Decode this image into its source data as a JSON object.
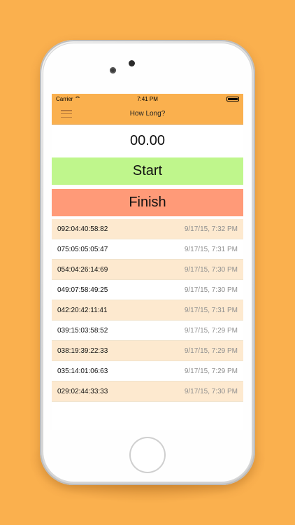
{
  "status_bar": {
    "carrier": "Carrier",
    "time": "7:41 PM"
  },
  "nav": {
    "title": "How Long?",
    "menu_icon": "hamburger-menu-icon"
  },
  "timer": {
    "display": "00.00"
  },
  "buttons": {
    "start": "Start",
    "finish": "Finish"
  },
  "records": [
    {
      "duration": "092:04:40:58:82",
      "date": "9/17/15, 7:32 PM"
    },
    {
      "duration": "075:05:05:05:47",
      "date": "9/17/15, 7:31 PM"
    },
    {
      "duration": "054:04:26:14:69",
      "date": "9/17/15, 7:30 PM"
    },
    {
      "duration": "049:07:58:49:25",
      "date": "9/17/15, 7:30 PM"
    },
    {
      "duration": "042:20:42:11:41",
      "date": "9/17/15, 7:31 PM"
    },
    {
      "duration": "039:15:03:58:52",
      "date": "9/17/15, 7:29 PM"
    },
    {
      "duration": "038:19:39:22:33",
      "date": "9/17/15, 7:29 PM"
    },
    {
      "duration": "035:14:01:06:63",
      "date": "9/17/15, 7:29 PM"
    },
    {
      "duration": "029:02:44:33:33",
      "date": "9/17/15, 7:30 PM"
    }
  ],
  "colors": {
    "background": "#FAB04E",
    "start_button": "#BFF68C",
    "finish_button": "#FF9A78",
    "row_alt": "#FDE9CF"
  }
}
